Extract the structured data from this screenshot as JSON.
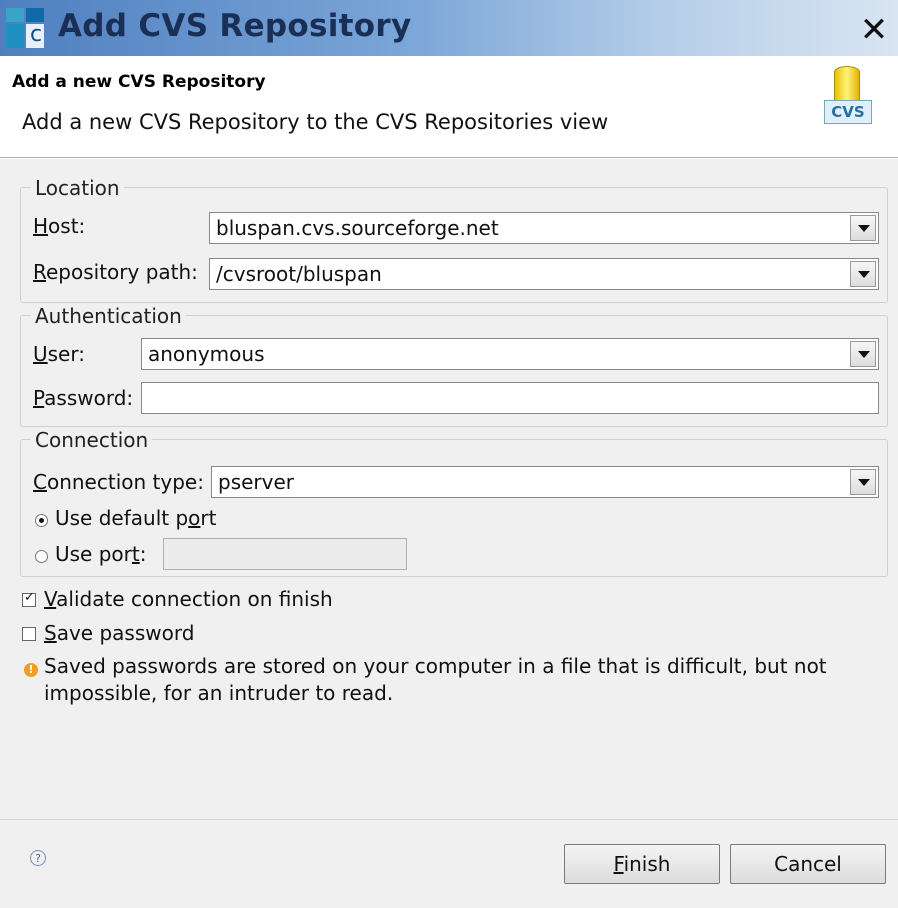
{
  "window": {
    "title": "Add CVS Repository",
    "close_glyph": "✕"
  },
  "header": {
    "title": "Add a new CVS Repository",
    "description": "Add a new CVS Repository to the CVS Repositories view",
    "icon_label": "CVS"
  },
  "location": {
    "legend": "Location",
    "host_label_u": "H",
    "host_label_rest": "ost:",
    "host_value": "bluspan.cvs.sourceforge.net",
    "path_label_u": "R",
    "path_label_rest": "epository path:",
    "path_value": "/cvsroot/bluspan"
  },
  "authentication": {
    "legend": "Authentication",
    "user_label_u": "U",
    "user_label_rest": "ser:",
    "user_value": "anonymous",
    "password_label_u": "P",
    "password_label_rest": "assword:",
    "password_value": ""
  },
  "connection": {
    "legend": "Connection",
    "type_label_pre": "",
    "type_label_u": "C",
    "type_label_rest": "onnection type:",
    "type_value": "pserver",
    "default_port_pre": "Use default p",
    "default_port_u": "o",
    "default_port_post": "rt",
    "use_port_pre": "Use por",
    "use_port_u": "t",
    "use_port_post": ":",
    "port_value": ""
  },
  "options": {
    "validate_u": "V",
    "validate_rest": "alidate connection on finish",
    "validate_checked": true,
    "save_u": "S",
    "save_rest": "ave password",
    "save_checked": false,
    "warning_line1": "Saved passwords are stored on your computer in a file that is difficult, but not",
    "warning_line2": "impossible, for an intruder to read."
  },
  "footer": {
    "help_glyph": "?",
    "finish_u": "F",
    "finish_rest": "inish",
    "cancel_label": "Cancel"
  }
}
